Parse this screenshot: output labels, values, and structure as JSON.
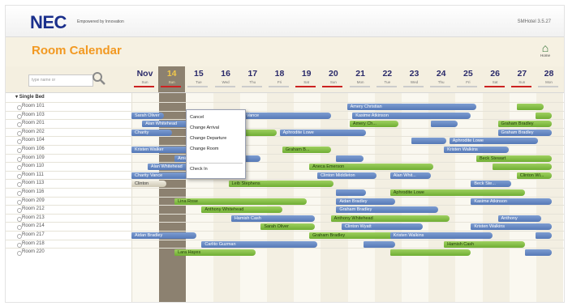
{
  "app": {
    "logo": "NEC",
    "tagline": "Empowered by Innovation",
    "version": "SMHotel 3.5.27"
  },
  "page_title": "Room Calendar",
  "home_label": "Home",
  "search": {
    "placeholder": "type name or"
  },
  "calendar": {
    "month_label": "Nov",
    "dates": [
      {
        "num": "14",
        "day": "Sun",
        "color": "#cc2222",
        "highlight": true
      },
      {
        "num": "15",
        "day": "Tue",
        "color": "#cccccc"
      },
      {
        "num": "16",
        "day": "Wed",
        "color": "#cccccc"
      },
      {
        "num": "17",
        "day": "Thu",
        "color": "#cccccc"
      },
      {
        "num": "18",
        "day": "Fri",
        "color": "#cccccc"
      },
      {
        "num": "19",
        "day": "Sat",
        "color": "#cc2222"
      },
      {
        "num": "20",
        "day": "Sun",
        "color": "#cc2222"
      },
      {
        "num": "21",
        "day": "Mon",
        "color": "#cccccc"
      },
      {
        "num": "22",
        "day": "Tue",
        "color": "#cccccc"
      },
      {
        "num": "23",
        "day": "Wed",
        "color": "#cccccc"
      },
      {
        "num": "24",
        "day": "Thu",
        "color": "#cccccc"
      },
      {
        "num": "25",
        "day": "Fri",
        "color": "#cccccc"
      },
      {
        "num": "26",
        "day": "Sat",
        "color": "#cc2222"
      },
      {
        "num": "27",
        "day": "Sun",
        "color": "#cc2222"
      },
      {
        "num": "28",
        "day": "Mon",
        "color": "#cccccc"
      }
    ],
    "first_day": "Sun"
  },
  "section_label": "Single Bed",
  "rooms": [
    {
      "name": "Room 101",
      "bars": [
        {
          "s": 8.0,
          "e": 12.8,
          "c": "b",
          "label": "Amery Christian"
        },
        {
          "s": 14.3,
          "e": 15.3,
          "c": "g",
          "label": ""
        }
      ]
    },
    {
      "name": "Room 103",
      "bars": [
        {
          "s": 0.0,
          "e": 1.2,
          "c": "b",
          "label": "Sarah Oliver"
        },
        {
          "s": 3.7,
          "e": 7.4,
          "c": "b",
          "label": "Linda Vance"
        },
        {
          "s": 8.2,
          "e": 12.6,
          "c": "b",
          "label": "Kasime Atkinson"
        },
        {
          "s": 15.0,
          "e": 15.6,
          "c": "g",
          "label": ""
        }
      ]
    },
    {
      "name": "Room 201",
      "bars": [
        {
          "s": 0.4,
          "e": 3.0,
          "c": "b",
          "label": "Alan Whitehead"
        },
        {
          "s": 8.1,
          "e": 9.9,
          "c": "g",
          "label": "Amery Ch..."
        },
        {
          "s": 11.1,
          "e": 12.1,
          "c": "b",
          "label": ""
        },
        {
          "s": 13.6,
          "e": 15.6,
          "c": "g",
          "label": "Graham Bradley"
        }
      ]
    },
    {
      "name": "Room 202",
      "bars": [
        {
          "s": 0.0,
          "e": 1.5,
          "c": "b",
          "label": "Charity"
        },
        {
          "s": 4.0,
          "e": 5.4,
          "c": "g",
          "label": ""
        },
        {
          "s": 5.5,
          "e": 8.7,
          "c": "b",
          "label": "Aphrodite Lowe"
        },
        {
          "s": 13.6,
          "e": 15.6,
          "c": "b",
          "label": "Graham Bradley"
        }
      ]
    },
    {
      "name": "Room 104",
      "bars": [
        {
          "s": 10.4,
          "e": 11.7,
          "c": "b",
          "label": ""
        },
        {
          "s": 11.8,
          "e": 15.1,
          "c": "b",
          "label": "Aphrodite Lowe"
        }
      ]
    },
    {
      "name": "Room 106",
      "bars": [
        {
          "s": 0.0,
          "e": 2.3,
          "c": "b",
          "label": "Kristen Walker"
        },
        {
          "s": 5.6,
          "e": 7.4,
          "c": "g",
          "label": "Graham B..."
        },
        {
          "s": 11.6,
          "e": 14.0,
          "c": "b",
          "label": "Kristen Walkins"
        }
      ]
    },
    {
      "name": "Room 109",
      "bars": [
        {
          "s": 1.6,
          "e": 4.8,
          "c": "b",
          "label": "Amery Christian"
        },
        {
          "s": 7.6,
          "e": 8.6,
          "c": "b",
          "label": ""
        },
        {
          "s": 12.8,
          "e": 15.6,
          "c": "g",
          "label": "Beck Stewart"
        }
      ]
    },
    {
      "name": "Room 110",
      "bars": [
        {
          "s": 0.6,
          "e": 3.5,
          "c": "b",
          "label": "Alan Whitehead"
        },
        {
          "s": 6.6,
          "e": 11.2,
          "c": "g",
          "label": "Aneca Emerson"
        },
        {
          "s": 13.4,
          "e": 15.6,
          "c": "g",
          "label": ""
        }
      ]
    },
    {
      "name": "Room 111",
      "bars": [
        {
          "s": 0.0,
          "e": 3.2,
          "c": "b",
          "label": "Charity Vance"
        },
        {
          "s": 6.9,
          "e": 9.1,
          "c": "b",
          "label": "Clinton Middleton"
        },
        {
          "s": 9.6,
          "e": 11.1,
          "c": "b",
          "label": "Alan Whit..."
        },
        {
          "s": 14.3,
          "e": 15.6,
          "c": "g",
          "label": "Clinton Wi..."
        }
      ]
    },
    {
      "name": "Room 113",
      "bars": [
        {
          "s": 0.0,
          "e": 1.3,
          "c": "t",
          "label": "Clinton"
        },
        {
          "s": 3.6,
          "e": 7.5,
          "c": "g",
          "label": "Leib Stephens"
        },
        {
          "s": 12.6,
          "e": 14.1,
          "c": "b",
          "label": "Beck Ste..."
        }
      ]
    },
    {
      "name": "Room 116",
      "bars": [
        {
          "s": 7.6,
          "e": 8.7,
          "c": "b",
          "label": ""
        },
        {
          "s": 9.6,
          "e": 14.6,
          "c": "g",
          "label": "Aphrodite Lowe"
        }
      ]
    },
    {
      "name": "Room 209",
      "bars": [
        {
          "s": 1.6,
          "e": 6.5,
          "c": "g",
          "label": "Lina Rose"
        },
        {
          "s": 7.6,
          "e": 9.8,
          "c": "b",
          "label": "Aidan Bradley"
        },
        {
          "s": 12.6,
          "e": 15.6,
          "c": "b",
          "label": "Kasime Atkinson"
        }
      ]
    },
    {
      "name": "Room 212",
      "bars": [
        {
          "s": 2.6,
          "e": 5.6,
          "c": "g",
          "label": "Anthony Whitehead"
        },
        {
          "s": 7.6,
          "e": 11.4,
          "c": "b",
          "label": "Graham Bradley"
        }
      ]
    },
    {
      "name": "Room 213",
      "bars": [
        {
          "s": 3.7,
          "e": 6.8,
          "c": "b",
          "label": "Hamish Cash"
        },
        {
          "s": 7.4,
          "e": 11.8,
          "c": "g",
          "label": "Anthony Whitehead"
        },
        {
          "s": 13.6,
          "e": 15.2,
          "c": "b",
          "label": "Anthony"
        }
      ]
    },
    {
      "name": "Room 214",
      "bars": [
        {
          "s": 4.8,
          "e": 6.8,
          "c": "g",
          "label": "Sarah Oliver"
        },
        {
          "s": 7.8,
          "e": 10.8,
          "c": "b",
          "label": "Clinton Wyatt"
        },
        {
          "s": 12.6,
          "e": 15.6,
          "c": "b",
          "label": "Kristen Walkins"
        }
      ]
    },
    {
      "name": "Room 217",
      "bars": [
        {
          "s": 0.0,
          "e": 2.4,
          "c": "b",
          "label": "Aidan Bradley"
        },
        {
          "s": 6.6,
          "e": 9.8,
          "c": "g",
          "label": "Graham Bradley"
        },
        {
          "s": 9.6,
          "e": 13.4,
          "c": "b",
          "label": "Kristen Walkins"
        },
        {
          "s": 15.0,
          "e": 15.6,
          "c": "b",
          "label": ""
        }
      ]
    },
    {
      "name": "Room 218",
      "bars": [
        {
          "s": 2.6,
          "e": 6.9,
          "c": "b",
          "label": "Carlito Guzman"
        },
        {
          "s": 8.6,
          "e": 9.8,
          "c": "b",
          "label": ""
        },
        {
          "s": 11.6,
          "e": 14.6,
          "c": "g",
          "label": "Hamish Cash"
        }
      ]
    },
    {
      "name": "Room 220",
      "bars": [
        {
          "s": 1.6,
          "e": 4.6,
          "c": "g",
          "label": "Lara Hayes"
        },
        {
          "s": 9.6,
          "e": 12.6,
          "c": "g",
          "label": ""
        },
        {
          "s": 14.6,
          "e": 15.6,
          "c": "b",
          "label": ""
        }
      ]
    }
  ],
  "context_menu": {
    "items": [
      "Cancel",
      "Change Arrival",
      "Change Departure",
      "Change Room",
      "Check In"
    ]
  },
  "colors": {
    "accent_title": "#f29922",
    "booking_blue": "#5679b7",
    "booking_green": "#6fae33",
    "weekend_red": "#cc2222",
    "today_highlight": "#8c8170"
  }
}
